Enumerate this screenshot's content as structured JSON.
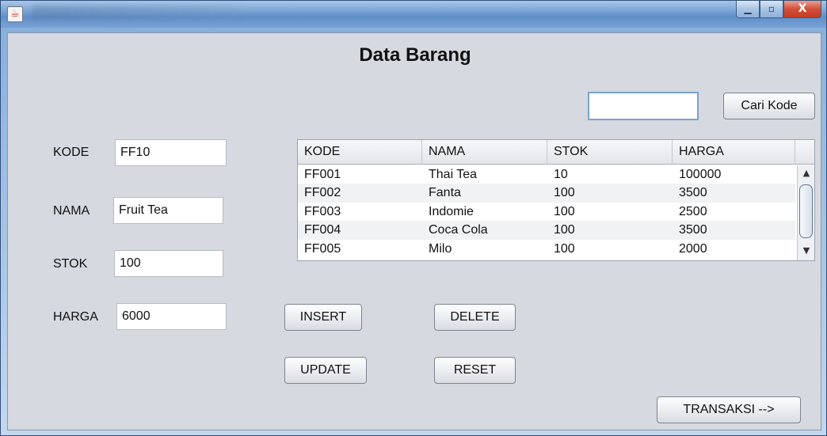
{
  "window": {
    "controls": {
      "minimize": "▁",
      "maximize": "▫",
      "close": "X"
    }
  },
  "form": {
    "heading": "Data Barang",
    "fields": {
      "kode": {
        "label": "KODE",
        "value": "FF10"
      },
      "nama": {
        "label": "NAMA",
        "value": "Fruit Tea"
      },
      "stok": {
        "label": "STOK",
        "value": "100"
      },
      "harga": {
        "label": "HARGA",
        "value": "6000"
      }
    },
    "search": {
      "value": "",
      "button": "Cari Kode"
    },
    "buttons": {
      "insert": "INSERT",
      "delete": "DELETE",
      "update": "UPDATE",
      "reset": "RESET",
      "transaksi": "TRANSAKSI -->"
    }
  },
  "table": {
    "headers": [
      "KODE",
      "NAMA",
      "STOK",
      "HARGA"
    ],
    "rows": [
      [
        "FF001",
        "Thai Tea",
        "10",
        "100000"
      ],
      [
        "FF002",
        "Fanta",
        "100",
        "3500"
      ],
      [
        "FF003",
        "Indomie",
        "100",
        "2500"
      ],
      [
        "FF004",
        "Coca Cola",
        "100",
        "3500"
      ],
      [
        "FF005",
        "Milo",
        "100",
        "2000"
      ]
    ]
  },
  "icons": {
    "app": "java-cup-icon",
    "scroll_up": "▲",
    "scroll_down": "▼"
  }
}
